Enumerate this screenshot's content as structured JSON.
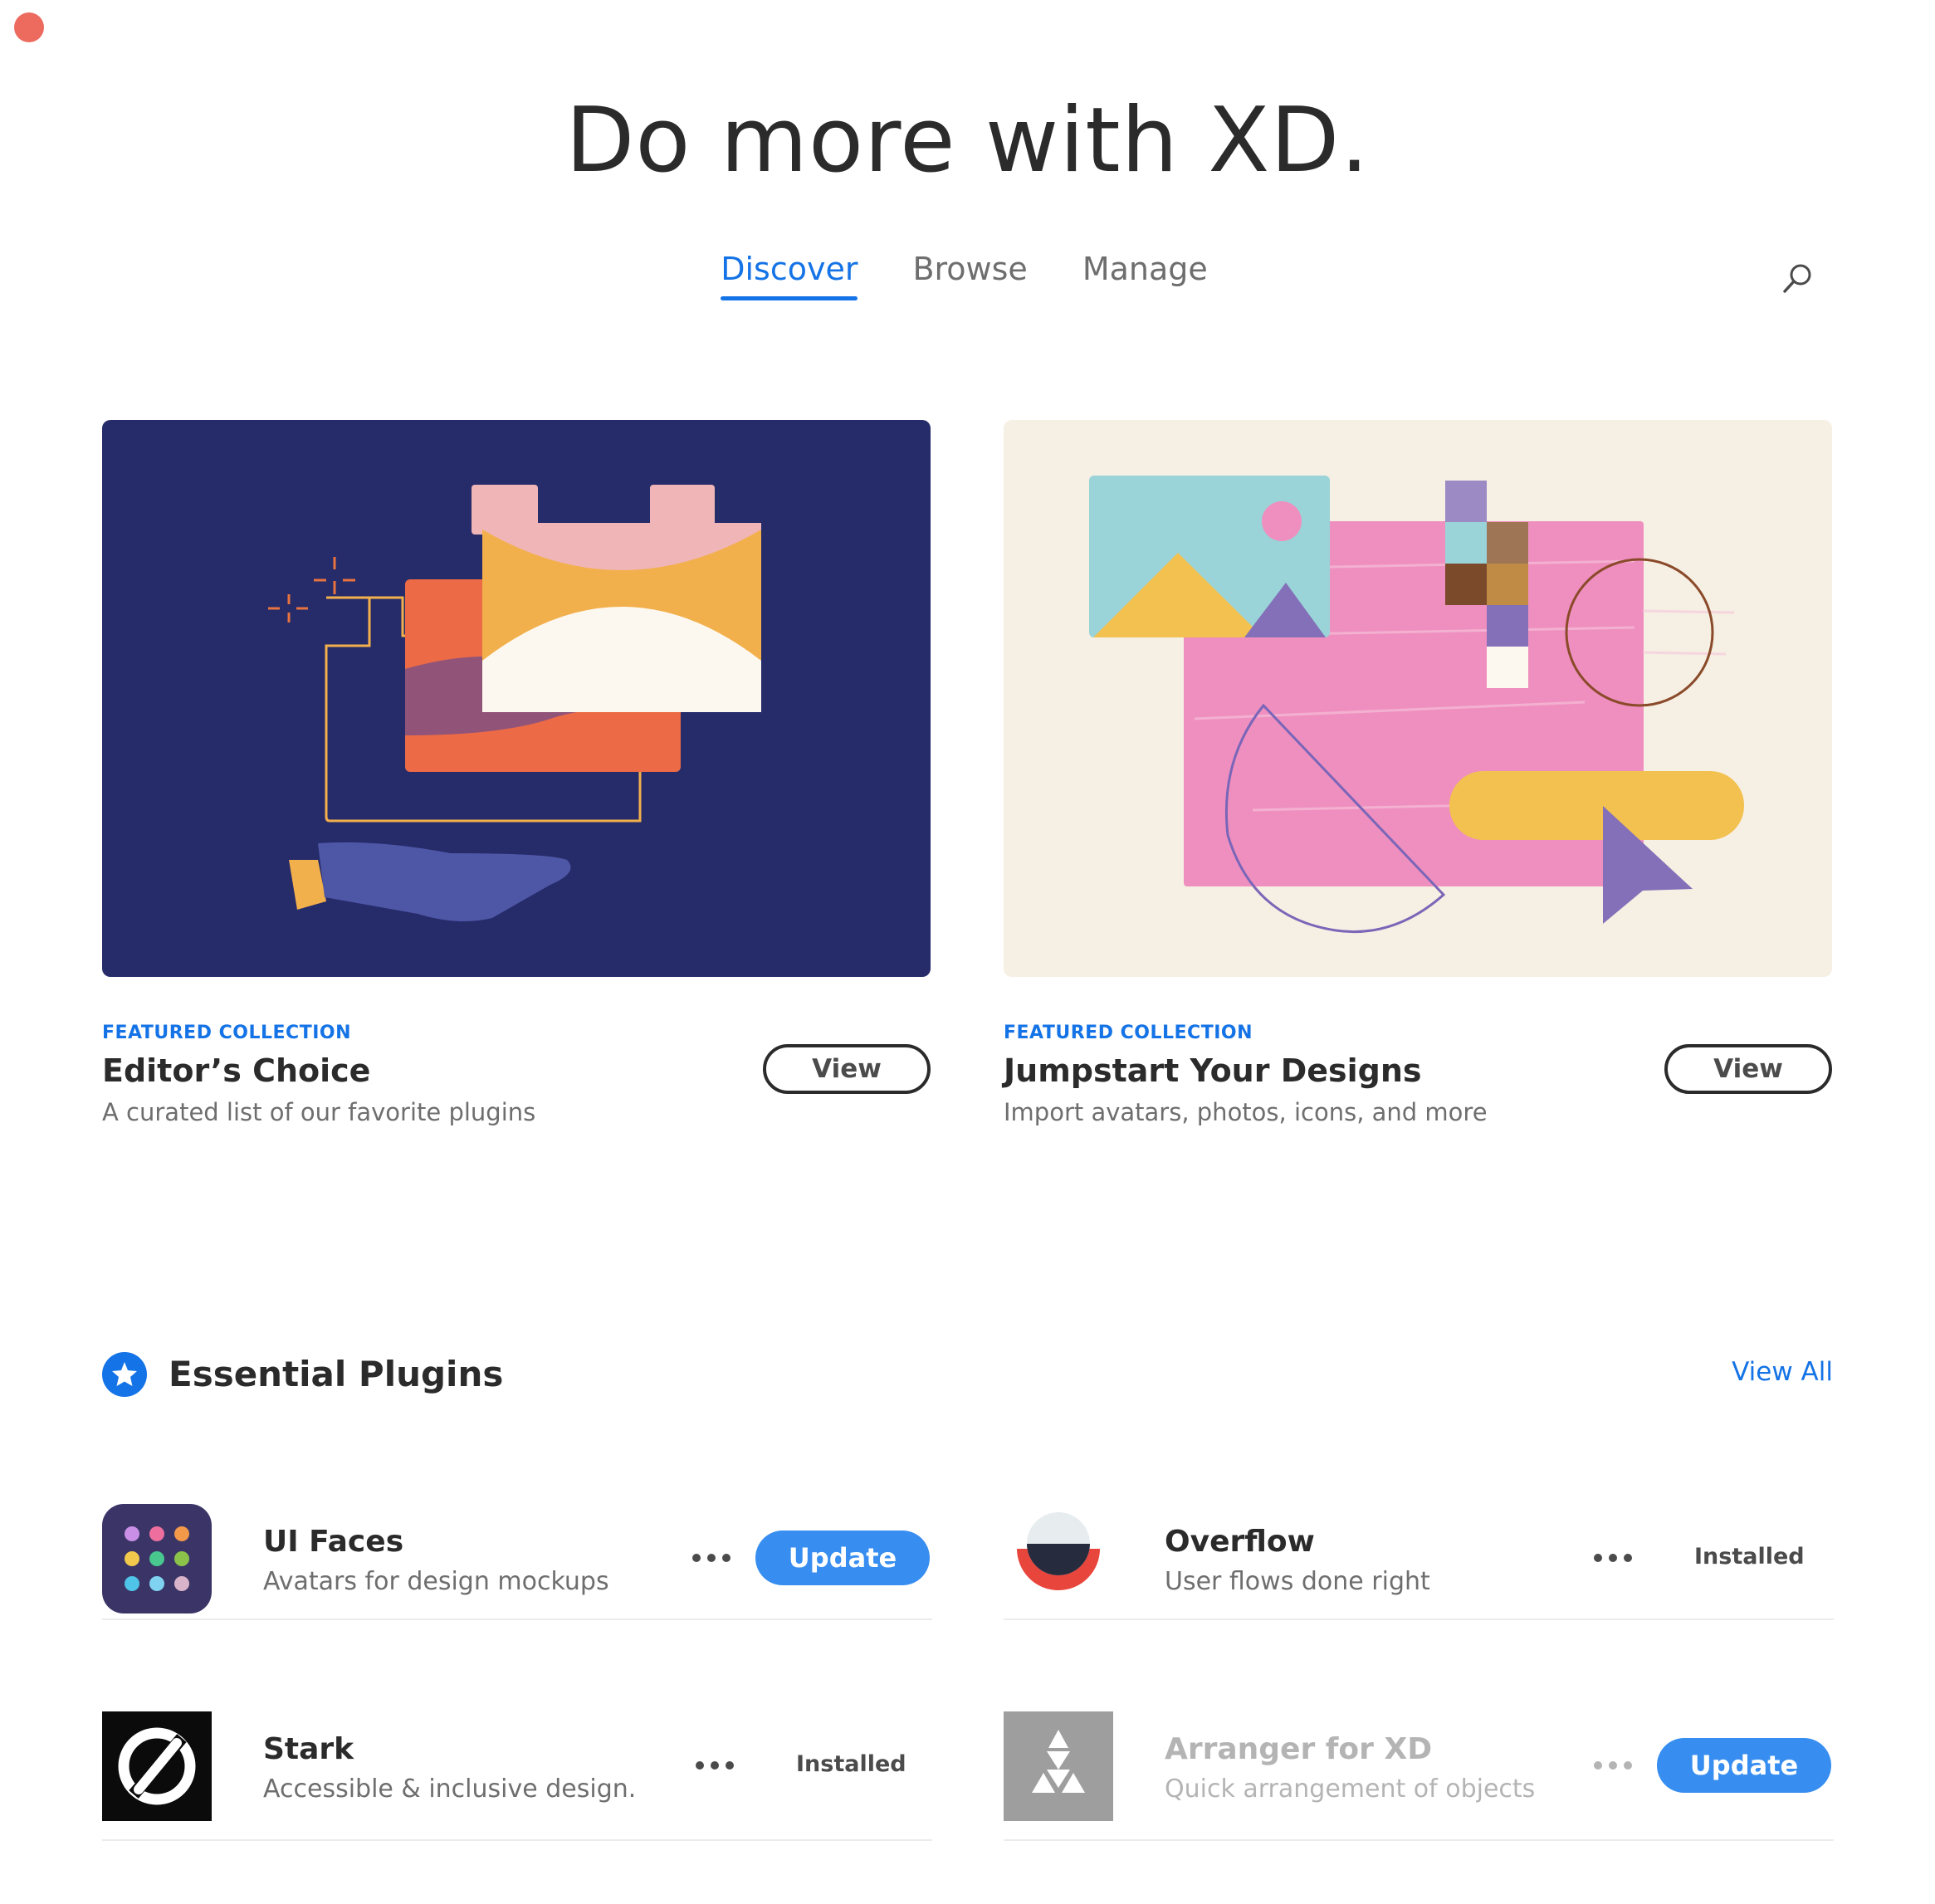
{
  "hero": {
    "title": "Do more with XD."
  },
  "tabs": [
    {
      "label": "Discover",
      "active": true
    },
    {
      "label": "Browse",
      "active": false
    },
    {
      "label": "Manage",
      "active": false
    }
  ],
  "search": {
    "icon": "search-icon"
  },
  "featured": [
    {
      "eyebrow": "FEATURED COLLECTION",
      "title": "Editor’s Choice",
      "subtitle": "A curated list of our favorite plugins",
      "button": "View",
      "background": "#262b6a"
    },
    {
      "eyebrow": "FEATURED COLLECTION",
      "title": "Jumpstart Your Designs",
      "subtitle": "Import avatars, photos, icons, and more",
      "button": "View",
      "background": "#f6efe3"
    }
  ],
  "essential": {
    "title": "Essential Plugins",
    "view_all": "View All",
    "icon": "star-icon",
    "plugins": [
      {
        "name": "UI Faces",
        "desc": "Avatars for design mockups",
        "action": "Update",
        "more": "more-icon"
      },
      {
        "name": "Overflow",
        "desc": "User flows done right",
        "action": "Installed",
        "more": "more-icon"
      },
      {
        "name": "Stark",
        "desc": "Accessible & inclusive design.",
        "action": "Installed",
        "more": "more-icon"
      },
      {
        "name": "Arranger for XD",
        "desc": "Quick arrangement of objects",
        "action": "Update",
        "more": "more-icon"
      }
    ]
  },
  "colors": {
    "accent": "#1473e6",
    "button_blue": "#378ef0",
    "close": "#ec6a5e"
  }
}
